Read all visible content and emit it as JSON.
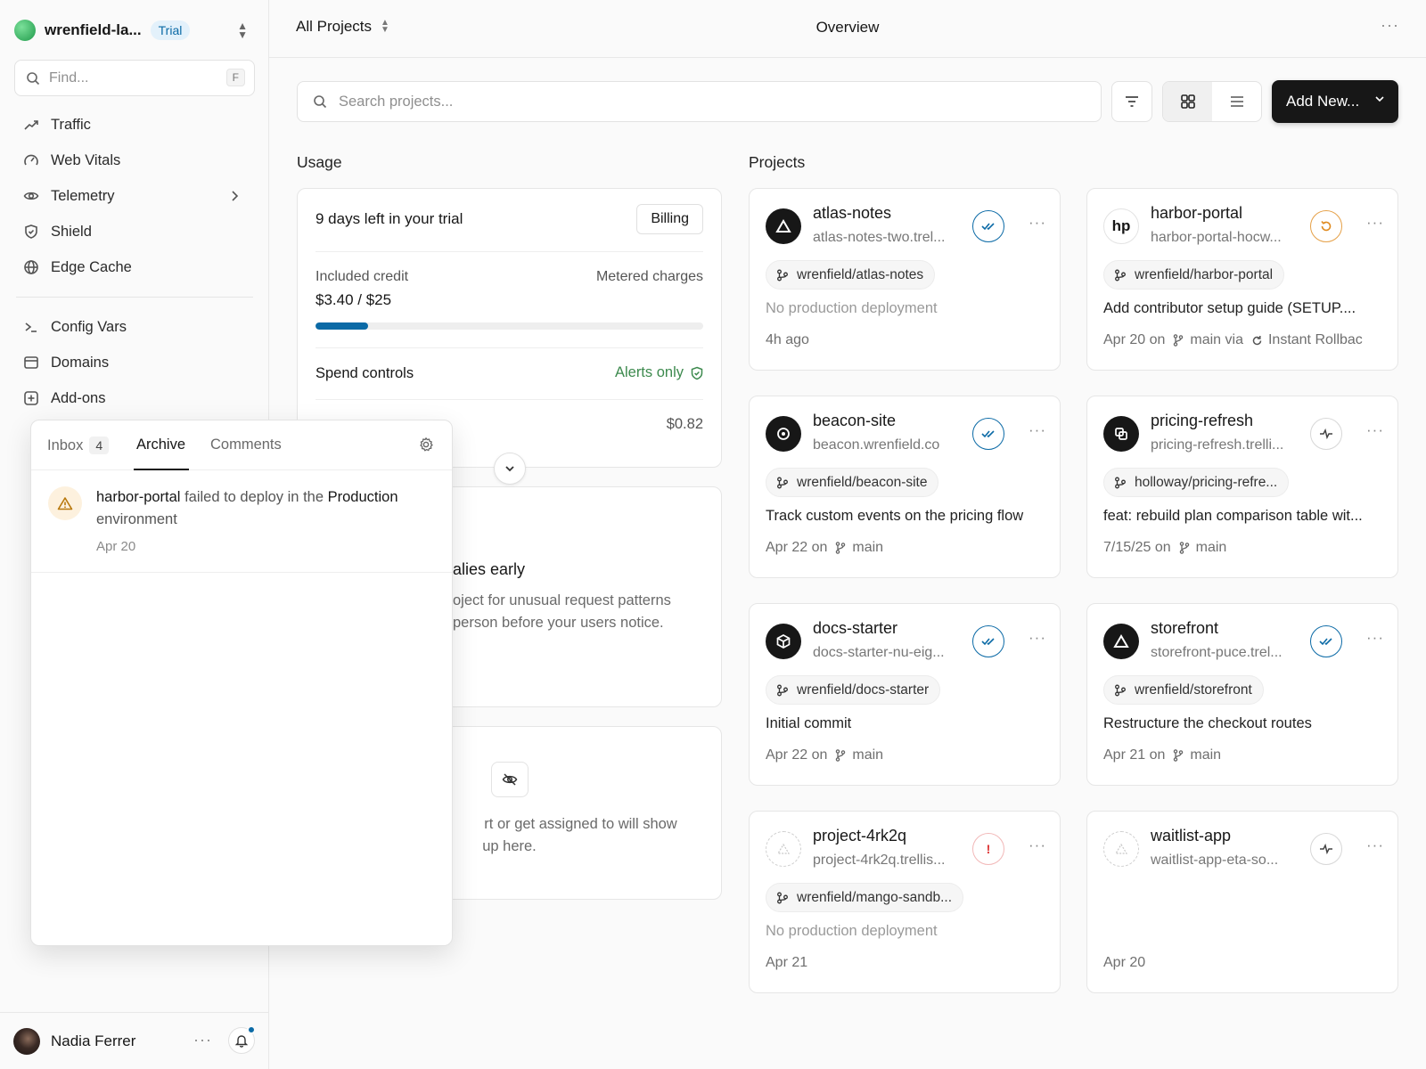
{
  "team": {
    "name": "wrenfield-la...",
    "plan_badge": "Trial"
  },
  "sidebar": {
    "find_placeholder": "Find...",
    "find_shortcut": "F",
    "items": [
      {
        "label": "Traffic",
        "icon": "trend-icon"
      },
      {
        "label": "Web Vitals",
        "icon": "gauge-icon"
      },
      {
        "label": "Telemetry",
        "icon": "eye-icon"
      },
      {
        "label": "Shield",
        "icon": "shield-icon"
      },
      {
        "label": "Edge Cache",
        "icon": "globe-icon"
      },
      {
        "label": "Config Vars",
        "icon": "terminal-icon"
      },
      {
        "label": "Domains",
        "icon": "browser-icon"
      },
      {
        "label": "Add-ons",
        "icon": "plus-square-icon"
      }
    ],
    "user": {
      "name": "Nadia Ferrer"
    }
  },
  "header": {
    "scope": "All Projects",
    "title": "Overview"
  },
  "toolbar": {
    "search_placeholder": "Search projects...",
    "add_new_label": "Add New..."
  },
  "usage": {
    "section_label": "Usage",
    "trial_text": "9 days left in your trial",
    "billing_label": "Billing",
    "credit_label": "Included credit",
    "credit_value": "$3.40 / $25",
    "credit_fraction": 0.136,
    "metered_label": "Metered charges",
    "spend_label": "Spend controls",
    "spend_value": "Alerts only",
    "charge_value": "$0.82"
  },
  "anomaly": {
    "title": "alies early",
    "desc_1": "oject for unusual request patterns",
    "desc_2": "person before your users notice."
  },
  "assigned": {
    "line_1": "rt or get assigned to will show",
    "line_2": "up here."
  },
  "projects": {
    "section_label": "Projects",
    "items": [
      {
        "name": "atlas-notes",
        "url": "atlas-notes-two.trel...",
        "repo": "wrenfield/atlas-notes",
        "commit": "No production deployment",
        "date": "4h ago",
        "branch": "",
        "via": "",
        "logo": "triangle",
        "status": "ready"
      },
      {
        "name": "harbor-portal",
        "url": "harbor-portal-hocw...",
        "repo": "wrenfield/harbor-portal",
        "commit": "Add contributor setup guide (SETUP....",
        "date": "Apr 20 on",
        "branch": "main via",
        "via": "Instant Rollbac",
        "logo": "hp",
        "status": "rollback"
      },
      {
        "name": "beacon-site",
        "url": "beacon.wrenfield.co",
        "repo": "wrenfield/beacon-site",
        "commit": "Track custom events on the pricing flow",
        "date": "Apr 22 on",
        "branch": "main",
        "via": "",
        "logo": "target",
        "status": "ready"
      },
      {
        "name": "pricing-refresh",
        "url": "pricing-refresh.trelli...",
        "repo": "holloway/pricing-refre...",
        "commit": "feat: rebuild plan comparison table wit...",
        "date": "7/15/25 on",
        "branch": "main",
        "via": "",
        "logo": "squares",
        "status": "pulse"
      },
      {
        "name": "docs-starter",
        "url": "docs-starter-nu-eig...",
        "repo": "wrenfield/docs-starter",
        "commit": "Initial commit",
        "date": "Apr 22 on",
        "branch": "main",
        "via": "",
        "logo": "cube",
        "status": "ready"
      },
      {
        "name": "storefront",
        "url": "storefront-puce.trel...",
        "repo": "wrenfield/storefront",
        "commit": "Restructure the checkout routes",
        "date": "Apr 21 on",
        "branch": "main",
        "via": "",
        "logo": "triangle",
        "status": "ready"
      },
      {
        "name": "project-4rk2q",
        "url": "project-4rk2q.trellis...",
        "repo": "wrenfield/mango-sandb...",
        "commit": "No production deployment",
        "date": "Apr 21",
        "branch": "",
        "via": "",
        "logo": "dashed",
        "status": "error"
      },
      {
        "name": "waitlist-app",
        "url": "waitlist-app-eta-so...",
        "repo": "",
        "commit": "",
        "date": "Apr 20",
        "branch": "",
        "via": "",
        "logo": "dashed",
        "status": "pulse"
      }
    ]
  },
  "notifications": {
    "tab_inbox": "Inbox",
    "inbox_count": "4",
    "tab_archive": "Archive",
    "tab_comments": "Comments",
    "item": {
      "project": "harbor-portal",
      "text": "failed to deploy in the",
      "environment": "Production",
      "suffix": "environment",
      "date": "Apr 20"
    }
  }
}
